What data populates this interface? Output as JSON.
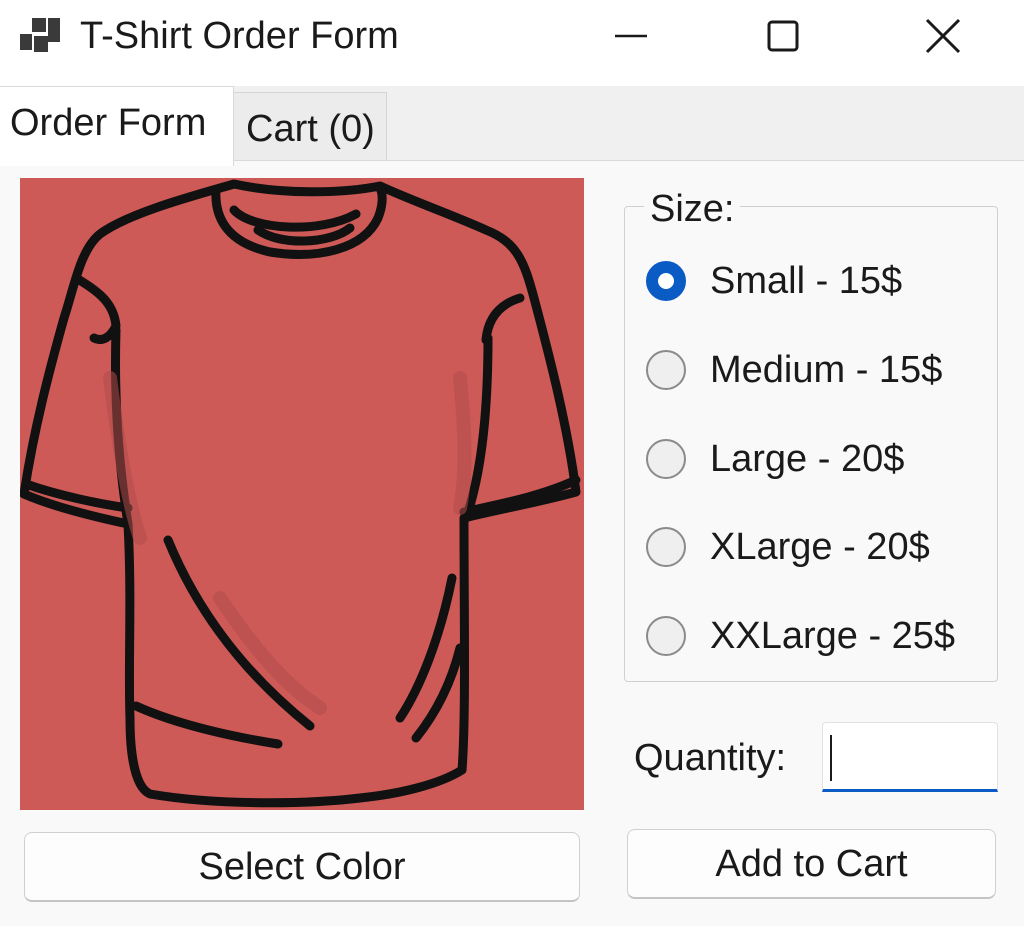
{
  "window": {
    "title": "T-Shirt Order Form",
    "controls": [
      "minimize",
      "maximize",
      "close"
    ]
  },
  "tabs": [
    {
      "label": "Order Form",
      "selected": true
    },
    {
      "label": "Cart (0)",
      "selected": false
    }
  ],
  "preview": {
    "shirt_color": "#cd5a57",
    "select_color_label": "Select Color"
  },
  "size": {
    "label": "Size:",
    "options": [
      {
        "label": "Small - 15$",
        "checked": true
      },
      {
        "label": "Medium - 15$",
        "checked": false
      },
      {
        "label": "Large - 20$",
        "checked": false
      },
      {
        "label": "XLarge - 20$",
        "checked": false
      },
      {
        "label": "XXLarge - 25$",
        "checked": false
      }
    ]
  },
  "quantity": {
    "label": "Quantity:",
    "value": ""
  },
  "add_to_cart_label": "Add to Cart",
  "colors": {
    "accent": "#0a5bc4",
    "shirt": "#cd5a57"
  }
}
